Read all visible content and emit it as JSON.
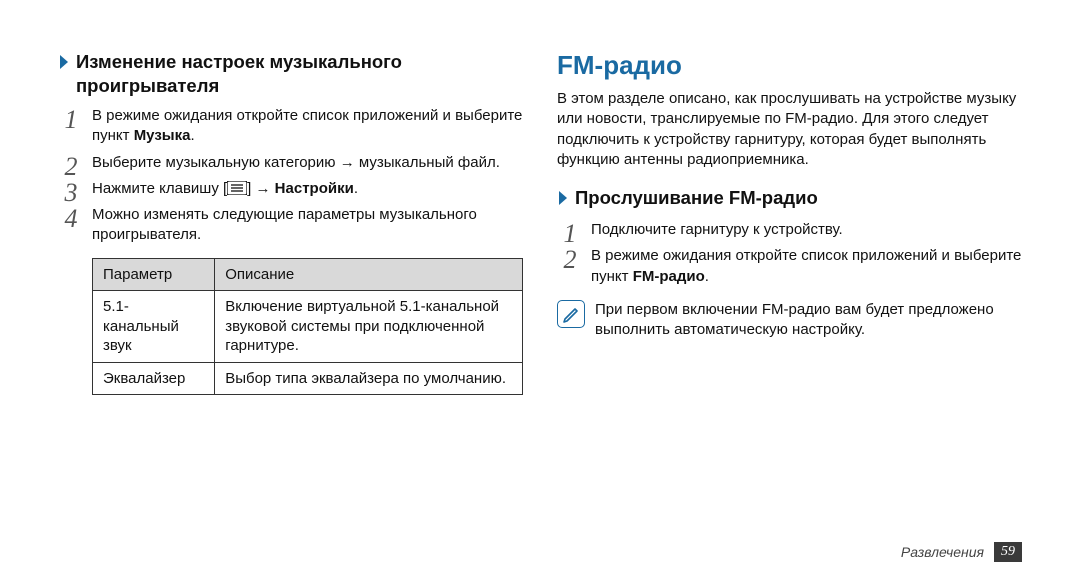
{
  "left": {
    "heading": "Изменение настроек музыкального проигрывателя",
    "steps": [
      {
        "pre": "В режиме ожидания откройте список приложений и выберите пункт ",
        "bold": "Музыка",
        "post": "."
      },
      {
        "pre": "Выберите музыкальную категорию → музыкальный файл.",
        "bold": "",
        "post": ""
      },
      {
        "pre": "Нажмите клавишу [",
        "icon": true,
        "mid": "] → ",
        "bold": "Настройки",
        "post": "."
      },
      {
        "pre": "Можно изменять следующие параметры музыкального проигрывателя.",
        "bold": "",
        "post": ""
      }
    ],
    "table": {
      "headers": [
        "Параметр",
        "Описание"
      ],
      "rows": [
        [
          "5.1-канальный звук",
          "Включение виртуальной 5.1-канальной звуковой системы при подключенной гарнитуре."
        ],
        [
          "Эквалайзер",
          "Выбор типа эквалайзера по умолчанию."
        ]
      ]
    }
  },
  "right": {
    "title": "FM-радио",
    "intro": "В этом разделе описано, как прослушивать на устройстве музыку или новости, транслируемые по FM-радио. Для этого следует подключить к устройству гарнитуру, которая будет выполнять функцию антенны радиоприемника.",
    "sub_heading": "Прослушивание FM-радио",
    "steps": [
      {
        "pre": "Подключите гарнитуру к устройству.",
        "bold": "",
        "post": ""
      },
      {
        "pre": "В режиме ожидания откройте список приложений и выберите пункт ",
        "bold": "FM-радио",
        "post": "."
      }
    ],
    "note": "При первом включении FM-радио вам будет предложено выполнить автоматическую настройку."
  },
  "footer": {
    "section": "Развлечения",
    "page": "59"
  }
}
